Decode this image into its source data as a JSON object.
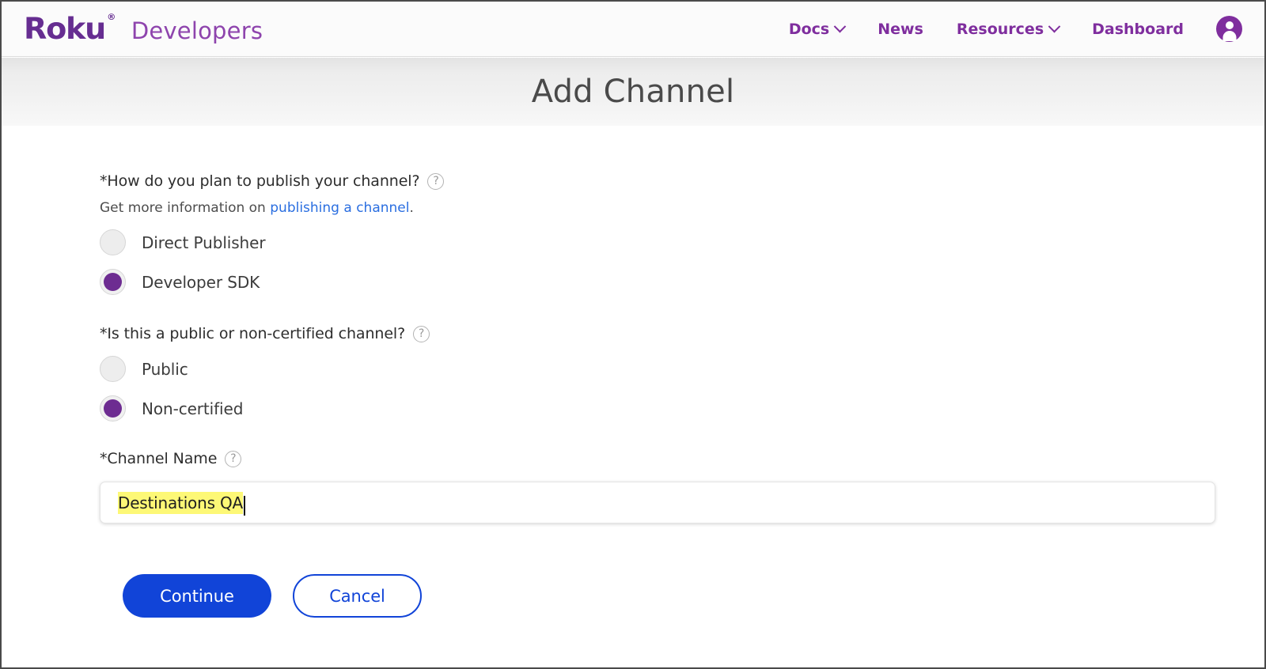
{
  "nav": {
    "brand_logo": "Roku",
    "brand_registered": "®",
    "brand_sub": "Developers",
    "items": [
      {
        "label": "Docs",
        "icon": "chevron-down-icon",
        "has_chevron": true
      },
      {
        "label": "News",
        "icon": "",
        "has_chevron": false
      },
      {
        "label": "Resources",
        "icon": "chevron-down-icon",
        "has_chevron": true
      },
      {
        "label": "Dashboard",
        "icon": "",
        "has_chevron": false
      }
    ],
    "avatar_icon": "user-account-icon"
  },
  "banner": {
    "title": "Add Channel"
  },
  "form": {
    "publish_question": {
      "label": "*How do you plan to publish your channel?",
      "help_icon": "?",
      "subtext_prefix": "Get more information on ",
      "subtext_link": "publishing a channel",
      "subtext_suffix": ".",
      "options": [
        {
          "label": "Direct Publisher",
          "checked": false
        },
        {
          "label": "Developer SDK",
          "checked": true
        }
      ]
    },
    "certification_question": {
      "label": "*Is this a public or non-certified channel?",
      "help_icon": "?",
      "options": [
        {
          "label": "Public",
          "checked": false
        },
        {
          "label": "Non-certified",
          "checked": true
        }
      ]
    },
    "channel_name": {
      "label": "*Channel Name",
      "help_icon": "?",
      "value": "Destinations QA",
      "placeholder": ""
    },
    "actions": {
      "continue_label": "Continue",
      "cancel_label": "Cancel"
    }
  },
  "colors": {
    "brand_purple": "#662d91",
    "nav_purple": "#7f2e9e",
    "radio_selected": "#6d2c91",
    "primary_button": "#1144d8",
    "link_blue": "#2a6ee0",
    "highlight_yellow": "#fdf876"
  }
}
